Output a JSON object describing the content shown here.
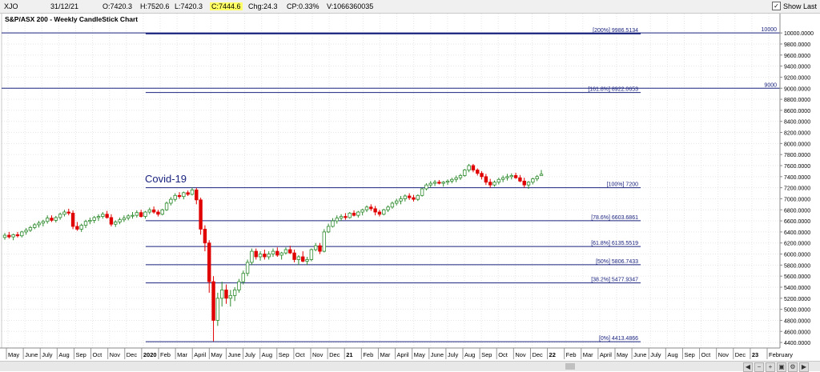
{
  "header": {
    "symbol": "XJO",
    "date": "31/12/21",
    "open": "O:7420.3",
    "high": "H:7520.6",
    "low": "L:7420.3",
    "close": "C:7444.6",
    "change": "Chg:24.3",
    "change_pct": "CP:0.33%",
    "volume": "V:1066360035",
    "show_last_label": "Show Last",
    "show_last_checked": true
  },
  "colors": {
    "up": "#2e8b2e",
    "down": "#e00000",
    "fib_line": "#1a237e",
    "label_text": "#1a237e",
    "grid": "#c8c8c8"
  },
  "chart_data": {
    "type": "candlestick",
    "title": "S&P/ASX 200 - Weekly CandleStick Chart",
    "annotation": "Covid-19",
    "y_axis": {
      "range": [
        4300,
        10350
      ],
      "ticks": [
        "10000.0000",
        "9800.0000",
        "9600.0000",
        "9400.0000",
        "9200.0000",
        "9000.0000",
        "8800.0000",
        "8600.0000",
        "8400.0000",
        "8200.0000",
        "8000.0000",
        "7800.0000",
        "7600.0000",
        "7400.0000",
        "7200.0000",
        "7000.0000",
        "6800.0000",
        "6600.0000",
        "6400.0000",
        "6200.0000",
        "6000.0000",
        "5800.0000",
        "5600.0000",
        "5400.0000",
        "5200.0000",
        "5000.0000",
        "4800.0000",
        "4600.0000",
        "4400.0000"
      ]
    },
    "x_axis": {
      "labels": [
        "May",
        "June",
        "July",
        "Aug",
        "Sep",
        "Oct",
        "Nov",
        "Dec",
        "2020",
        "Feb",
        "Mar",
        "April",
        "May",
        "June",
        "July",
        "Aug",
        "Sep",
        "Oct",
        "Nov",
        "Dec",
        "21",
        "Feb",
        "Mar",
        "April",
        "May",
        "June",
        "July",
        "Aug",
        "Sep",
        "Oct",
        "Nov",
        "Dec",
        "22",
        "Feb",
        "Mar",
        "April",
        "May",
        "June",
        "July",
        "Aug",
        "Sep",
        "Oct",
        "Nov",
        "Dec",
        "23",
        "February"
      ],
      "bold_labels": [
        "2020",
        "21",
        "22",
        "23"
      ]
    },
    "levels": [
      {
        "label": "[200%] 9986.5134",
        "value": 9986.5134,
        "start": "2020",
        "bold": true
      },
      {
        "label": "[161.8%] 8922.0653",
        "value": 8922.0653,
        "start": "2020",
        "bold": false
      },
      {
        "label": "[100%] 7200",
        "value": 7200,
        "start": "2020",
        "bold": false
      },
      {
        "label": "[78.6%] 6603.6861",
        "value": 6603.6861,
        "start": "2020",
        "bold": false
      },
      {
        "label": "[61.8%] 6135.5519",
        "value": 6135.5519,
        "start": "2020",
        "bold": false
      },
      {
        "label": "[50%] 5806.7433",
        "value": 5806.7433,
        "start": "2020",
        "bold": false
      },
      {
        "label": "[38.2%] 5477.9347",
        "value": 5477.9347,
        "start": "2020",
        "bold": false
      },
      {
        "label": "[0%] 4413.4866",
        "value": 4413.4866,
        "start": "2020",
        "bold": false
      }
    ],
    "hlines": [
      {
        "label": "10000",
        "value": 10000
      },
      {
        "label": "9000",
        "value": 9000
      }
    ],
    "candles": [
      [
        6300,
        6380,
        6260,
        6340
      ],
      [
        6340,
        6400,
        6280,
        6310
      ],
      [
        6310,
        6370,
        6250,
        6350
      ],
      [
        6350,
        6400,
        6300,
        6330
      ],
      [
        6330,
        6420,
        6300,
        6400
      ],
      [
        6400,
        6470,
        6350,
        6430
      ],
      [
        6430,
        6510,
        6400,
        6480
      ],
      [
        6480,
        6560,
        6450,
        6530
      ],
      [
        6530,
        6600,
        6480,
        6560
      ],
      [
        6560,
        6620,
        6500,
        6590
      ],
      [
        6590,
        6700,
        6550,
        6650
      ],
      [
        6650,
        6700,
        6580,
        6610
      ],
      [
        6610,
        6690,
        6570,
        6660
      ],
      [
        6660,
        6750,
        6620,
        6720
      ],
      [
        6720,
        6800,
        6680,
        6760
      ],
      [
        6760,
        6820,
        6700,
        6740
      ],
      [
        6740,
        6790,
        6450,
        6500
      ],
      [
        6500,
        6580,
        6420,
        6450
      ],
      [
        6450,
        6550,
        6400,
        6520
      ],
      [
        6520,
        6620,
        6470,
        6590
      ],
      [
        6590,
        6660,
        6540,
        6610
      ],
      [
        6610,
        6690,
        6560,
        6660
      ],
      [
        6660,
        6720,
        6600,
        6680
      ],
      [
        6680,
        6760,
        6640,
        6720
      ],
      [
        6720,
        6780,
        6640,
        6660
      ],
      [
        6660,
        6720,
        6500,
        6540
      ],
      [
        6540,
        6610,
        6490,
        6580
      ],
      [
        6580,
        6660,
        6540,
        6620
      ],
      [
        6620,
        6700,
        6580,
        6650
      ],
      [
        6650,
        6720,
        6610,
        6690
      ],
      [
        6690,
        6760,
        6640,
        6700
      ],
      [
        6700,
        6790,
        6660,
        6750
      ],
      [
        6750,
        6800,
        6660,
        6680
      ],
      [
        6680,
        6780,
        6640,
        6760
      ],
      [
        6760,
        6840,
        6720,
        6800
      ],
      [
        6800,
        6860,
        6730,
        6760
      ],
      [
        6760,
        6800,
        6680,
        6720
      ],
      [
        6720,
        6820,
        6700,
        6800
      ],
      [
        6800,
        6950,
        6780,
        6920
      ],
      [
        6920,
        7030,
        6880,
        6990
      ],
      [
        6990,
        7100,
        6950,
        7060
      ],
      [
        7060,
        7120,
        7000,
        7040
      ],
      [
        7040,
        7130,
        6990,
        7110
      ],
      [
        7110,
        7150,
        7050,
        7080
      ],
      [
        7080,
        7200,
        7060,
        7160
      ],
      [
        7160,
        7197,
        6900,
        6980
      ],
      [
        6980,
        7020,
        6350,
        6450
      ],
      [
        6450,
        6520,
        6050,
        6200
      ],
      [
        6200,
        6250,
        5300,
        5500
      ],
      [
        5500,
        5600,
        4420,
        4800
      ],
      [
        4800,
        5300,
        4700,
        5200
      ],
      [
        5200,
        5500,
        5050,
        5350
      ],
      [
        5350,
        5450,
        5100,
        5200
      ],
      [
        5200,
        5350,
        5050,
        5250
      ],
      [
        5250,
        5400,
        5150,
        5350
      ],
      [
        5350,
        5550,
        5300,
        5500
      ],
      [
        5500,
        5700,
        5450,
        5650
      ],
      [
        5650,
        5900,
        5600,
        5850
      ],
      [
        5850,
        6100,
        5800,
        6050
      ],
      [
        6050,
        6100,
        5900,
        5950
      ],
      [
        5950,
        6050,
        5880,
        6000
      ],
      [
        6000,
        6080,
        5900,
        5950
      ],
      [
        5950,
        6050,
        5900,
        6000
      ],
      [
        6000,
        6100,
        5950,
        6050
      ],
      [
        6050,
        6120,
        5950,
        5980
      ],
      [
        5980,
        6040,
        5900,
        6020
      ],
      [
        6020,
        6120,
        5990,
        6080
      ],
      [
        6080,
        6150,
        6000,
        6020
      ],
      [
        6020,
        6080,
        5850,
        5900
      ],
      [
        5900,
        5980,
        5800,
        5950
      ],
      [
        5950,
        6050,
        5850,
        5870
      ],
      [
        5870,
        5950,
        5800,
        5900
      ],
      [
        5900,
        6100,
        5870,
        6080
      ],
      [
        6080,
        6200,
        6050,
        6150
      ],
      [
        6150,
        6200,
        6000,
        6050
      ],
      [
        6050,
        6450,
        6030,
        6400
      ],
      [
        6400,
        6550,
        6380,
        6500
      ],
      [
        6500,
        6650,
        6480,
        6600
      ],
      [
        6600,
        6700,
        6550,
        6650
      ],
      [
        6650,
        6720,
        6600,
        6680
      ],
      [
        6680,
        6740,
        6620,
        6660
      ],
      [
        6660,
        6760,
        6640,
        6740
      ],
      [
        6740,
        6790,
        6680,
        6700
      ],
      [
        6700,
        6780,
        6660,
        6760
      ],
      [
        6760,
        6820,
        6700,
        6800
      ],
      [
        6800,
        6880,
        6760,
        6850
      ],
      [
        6850,
        6900,
        6780,
        6820
      ],
      [
        6820,
        6870,
        6700,
        6760
      ],
      [
        6760,
        6800,
        6680,
        6720
      ],
      [
        6720,
        6820,
        6700,
        6800
      ],
      [
        6800,
        6880,
        6760,
        6850
      ],
      [
        6850,
        6950,
        6820,
        6920
      ],
      [
        6920,
        7000,
        6880,
        6960
      ],
      [
        6960,
        7050,
        6900,
        7000
      ],
      [
        7000,
        7080,
        6950,
        7050
      ],
      [
        7050,
        7100,
        6980,
        7020
      ],
      [
        7020,
        7070,
        6950,
        6990
      ],
      [
        6990,
        7080,
        6960,
        7060
      ],
      [
        7060,
        7200,
        7040,
        7180
      ],
      [
        7180,
        7280,
        7150,
        7250
      ],
      [
        7250,
        7320,
        7200,
        7280
      ],
      [
        7280,
        7340,
        7230,
        7300
      ],
      [
        7300,
        7340,
        7260,
        7280
      ],
      [
        7280,
        7320,
        7220,
        7300
      ],
      [
        7300,
        7350,
        7250,
        7320
      ],
      [
        7320,
        7380,
        7280,
        7350
      ],
      [
        7350,
        7420,
        7300,
        7380
      ],
      [
        7380,
        7450,
        7340,
        7420
      ],
      [
        7420,
        7540,
        7400,
        7520
      ],
      [
        7520,
        7630,
        7480,
        7600
      ],
      [
        7600,
        7630,
        7480,
        7520
      ],
      [
        7520,
        7550,
        7420,
        7460
      ],
      [
        7460,
        7500,
        7350,
        7400
      ],
      [
        7400,
        7450,
        7250,
        7300
      ],
      [
        7300,
        7360,
        7200,
        7250
      ],
      [
        7250,
        7330,
        7220,
        7300
      ],
      [
        7300,
        7380,
        7260,
        7350
      ],
      [
        7350,
        7420,
        7300,
        7380
      ],
      [
        7380,
        7450,
        7330,
        7400
      ],
      [
        7400,
        7460,
        7350,
        7420
      ],
      [
        7420,
        7470,
        7360,
        7380
      ],
      [
        7380,
        7430,
        7300,
        7320
      ],
      [
        7320,
        7380,
        7200,
        7250
      ],
      [
        7250,
        7320,
        7180,
        7300
      ],
      [
        7300,
        7380,
        7260,
        7360
      ],
      [
        7360,
        7430,
        7320,
        7400
      ],
      [
        7420.3,
        7520.6,
        7420.3,
        7444.6
      ]
    ]
  }
}
